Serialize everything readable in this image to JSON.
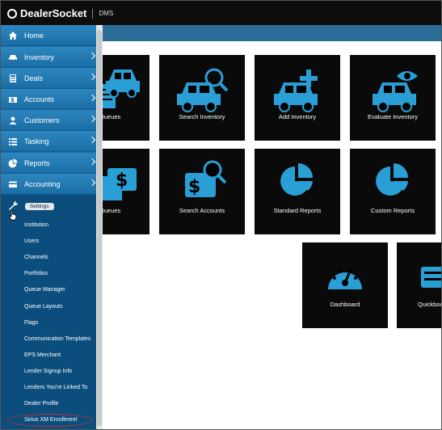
{
  "brand": {
    "name": "DealerSocket",
    "product": "DMS"
  },
  "menu": [
    {
      "label": "Home",
      "icon": "home-icon"
    },
    {
      "label": "Inventory",
      "icon": "car-icon"
    },
    {
      "label": "Deals",
      "icon": "calculator-icon"
    },
    {
      "label": "Accounts",
      "icon": "dollar-card-icon"
    },
    {
      "label": "Customers",
      "icon": "person-icon"
    },
    {
      "label": "Tasking",
      "icon": "list-icon"
    },
    {
      "label": "Reports",
      "icon": "pie-chart-icon"
    },
    {
      "label": "Accounting",
      "icon": "credit-card-icon"
    }
  ],
  "settings": {
    "label": "Settings",
    "items": [
      "Institution",
      "Users",
      "Channels",
      "Portfolios",
      "Queue Manager",
      "Queue Layouts",
      "Flags",
      "Communication Templates",
      "EPS Merchant",
      "Lender Signup Info",
      "Lenders You're Linked To",
      "Dealer Profile",
      "Sirius XM Enrollment"
    ]
  },
  "tiles": [
    {
      "label": "ry Queues",
      "icon": "inventory-queues-icon"
    },
    {
      "label": "Search Inventory",
      "icon": "search-car-icon"
    },
    {
      "label": "Add Inventory",
      "icon": "add-car-icon"
    },
    {
      "label": "Evaluate Inventory",
      "icon": "evaluate-car-icon"
    },
    {
      "label": "nt Queues",
      "icon": "account-queues-icon"
    },
    {
      "label": "Search Accounts",
      "icon": "search-accounts-icon"
    },
    {
      "label": "Standard Reports",
      "icon": "pie-chart-icon"
    },
    {
      "label": "Custom Reports",
      "icon": "pie-chart-icon"
    },
    {
      "label": "Dashboard",
      "icon": "gauge-icon"
    },
    {
      "label": "Quickboo",
      "icon": "quickbooks-icon"
    }
  ],
  "colors": {
    "accent": "#2a9fd6",
    "sidebar": "#1a6ea6",
    "highlight": "#c0332e"
  }
}
